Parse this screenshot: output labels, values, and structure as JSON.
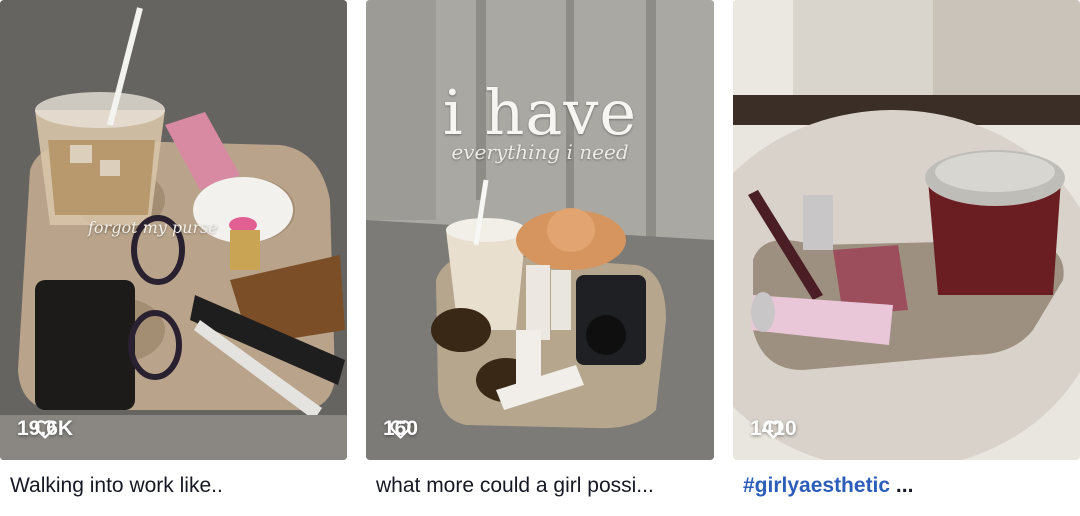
{
  "colors": {
    "caption_text": "#161823",
    "hashtag": "#2b5db9",
    "like_text": "#ffffff"
  },
  "icons": {
    "like": "heart-outline-icon"
  },
  "videos": [
    {
      "likes": "19.6K",
      "caption": "Walking into work like..",
      "overlay_text": "forgot my purse"
    },
    {
      "likes": "160",
      "caption": "what more could a girl possi...",
      "overlay_title": "i have",
      "overlay_subtitle": "everything i need"
    },
    {
      "likes": "1410",
      "caption_tag": "#girlyaesthetic",
      "caption_rest": " ..."
    }
  ]
}
